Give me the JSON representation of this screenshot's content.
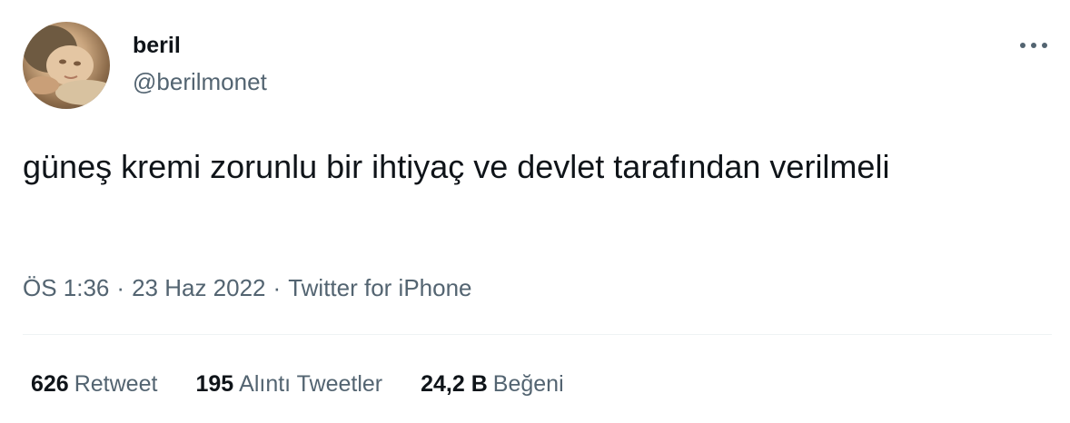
{
  "user": {
    "display_name": "beril",
    "handle": "@berilmonet",
    "avatar_icon": "avatar-photo"
  },
  "tweet": {
    "text": "güneş kremi zorunlu bir ihtiyaç ve devlet tarafından verilmeli"
  },
  "meta": {
    "time": "ÖS 1:36",
    "separator": "·",
    "date": "23 Haz 2022",
    "source": "Twitter for iPhone"
  },
  "stats": [
    {
      "count": "626",
      "label": "Retweet"
    },
    {
      "count": "195",
      "label": "Alıntı Tweetler"
    },
    {
      "count": "24,2 B",
      "label": "Beğeni"
    }
  ],
  "icons": {
    "more": "more-horizontal-icon"
  },
  "colors": {
    "text": "#0f1419",
    "secondary": "#536471",
    "divider": "#eff3f4"
  }
}
